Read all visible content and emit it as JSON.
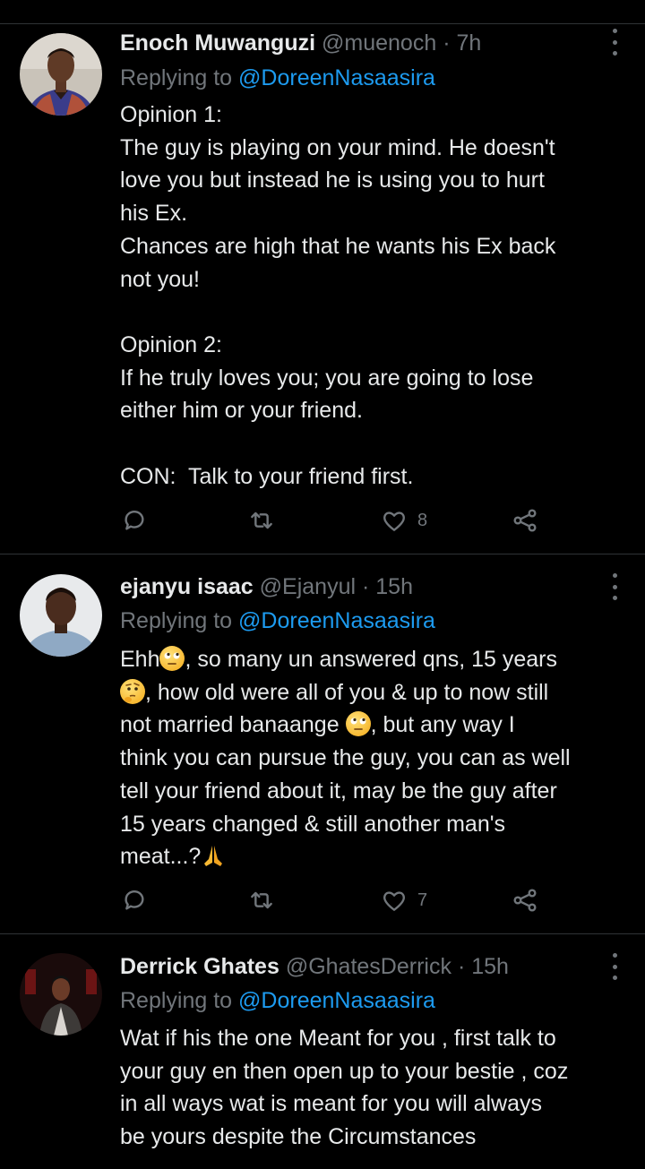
{
  "tweets": [
    {
      "name": "Enoch Muwanguzi",
      "handle": "@muenoch",
      "dot": "·",
      "time": "7h",
      "replying_prefix": "Replying to ",
      "replying_to": "@DoreenNasaasira",
      "body": "Opinion 1:\nThe guy is playing on your mind. He doesn't\nlove you but instead he is using you to hurt\nhis Ex.\nChances are high that he wants his Ex back\nnot you!\n\nOpinion 2:\nIf he truly loves you; you are going to lose\neither him or your friend.\n\nCON:  Talk to your friend first.",
      "likes": "8",
      "avatar_icon": "profile-photo"
    },
    {
      "name": "ejanyu isaac",
      "handle": "@Ejanyul",
      "dot": "·",
      "time": "15h",
      "replying_prefix": "Replying to ",
      "replying_to": "@DoreenNasaasira",
      "body_segments": [
        "Ehh",
        ", so many un answered qns, 15 years",
        ", how old were all of you & up to now still",
        "not married banaange ",
        ", but any way I",
        "think you can pursue the guy, you can as well",
        "tell your friend about it, may be the guy after",
        "15 years changed & still another man's",
        "meat...?"
      ],
      "emojis": [
        "face-with-rolling-eyes-emoji",
        "thinking-face-emoji",
        "face-with-rolling-eyes-emoji",
        "folded-hands-emoji"
      ],
      "likes": "7",
      "avatar_icon": "profile-photo"
    },
    {
      "name": "Derrick Ghates",
      "handle": "@GhatesDerrick",
      "dot": "·",
      "time": "15h",
      "replying_prefix": "Replying to ",
      "replying_to": "@DoreenNasaasira",
      "body": "Wat if his the one Meant for you , first talk to\nyour guy en then open up to your bestie , coz\nin all ways wat is meant for you will always\nbe yours despite the Circumstances",
      "avatar_icon": "profile-photo"
    }
  ],
  "icons": {
    "reply": "reply-icon",
    "retweet": "retweet-icon",
    "like": "like-icon",
    "share": "share-icon",
    "more": "more-options-icon"
  },
  "colors": {
    "background": "#000000",
    "text": "#e7e9ea",
    "secondary": "#71767b",
    "link": "#1d9bf0",
    "divider": "#2f3336"
  }
}
